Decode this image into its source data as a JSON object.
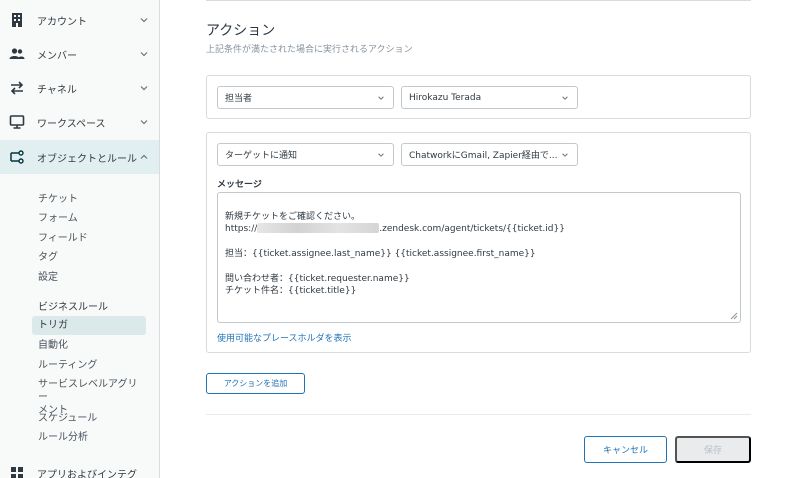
{
  "sidebar": {
    "nav": [
      {
        "label": "アカウント",
        "icon": "building-icon"
      },
      {
        "label": "メンバー",
        "icon": "people-icon"
      },
      {
        "label": "チャネル",
        "icon": "arrows-swap-icon"
      },
      {
        "label": "ワークスペース",
        "icon": "monitor-icon"
      },
      {
        "label": "オブジェクトとルール",
        "icon": "objects-rules-icon"
      }
    ],
    "sub_items": [
      "チケット",
      "フォーム",
      "フィールド",
      "タグ",
      "設定"
    ],
    "business_rules_heading": "ビジネスルール",
    "business_rules": [
      "トリガ",
      "自動化",
      "ルーティング",
      "サービスレベルアグリー",
      "メント",
      "スケジュール",
      "ルール分析"
    ],
    "apps_label": "アプリおよびインテグ"
  },
  "main": {
    "title": "アクション",
    "subtitle": "上記条件が満たされた場合に実行されるアクション",
    "action1": {
      "field": "担当者",
      "value": "Hirokazu Terada"
    },
    "action2": {
      "field": "ターゲットに通知",
      "value": "ChatworkにGmail, Zapier経由で..."
    },
    "message_label": "メッセージ",
    "message_lines": {
      "l1": "新規チケットをご確認ください。",
      "l2a": "https://",
      "l2b": ".zendesk.com/agent/tickets/{{ticket.id}}",
      "l3": "担当：{{ticket.assignee.last_name}} {{ticket.assignee.first_name}}",
      "l4": "問い合わせ者：{{ticket.requester.name}}",
      "l5": "チケット件名：{{ticket.title}}"
    },
    "placeholder_link": "使用可能なプレースホルダを表示",
    "add_action_button": "アクションを追加",
    "cancel_button": "キャンセル",
    "save_button": "保存"
  }
}
